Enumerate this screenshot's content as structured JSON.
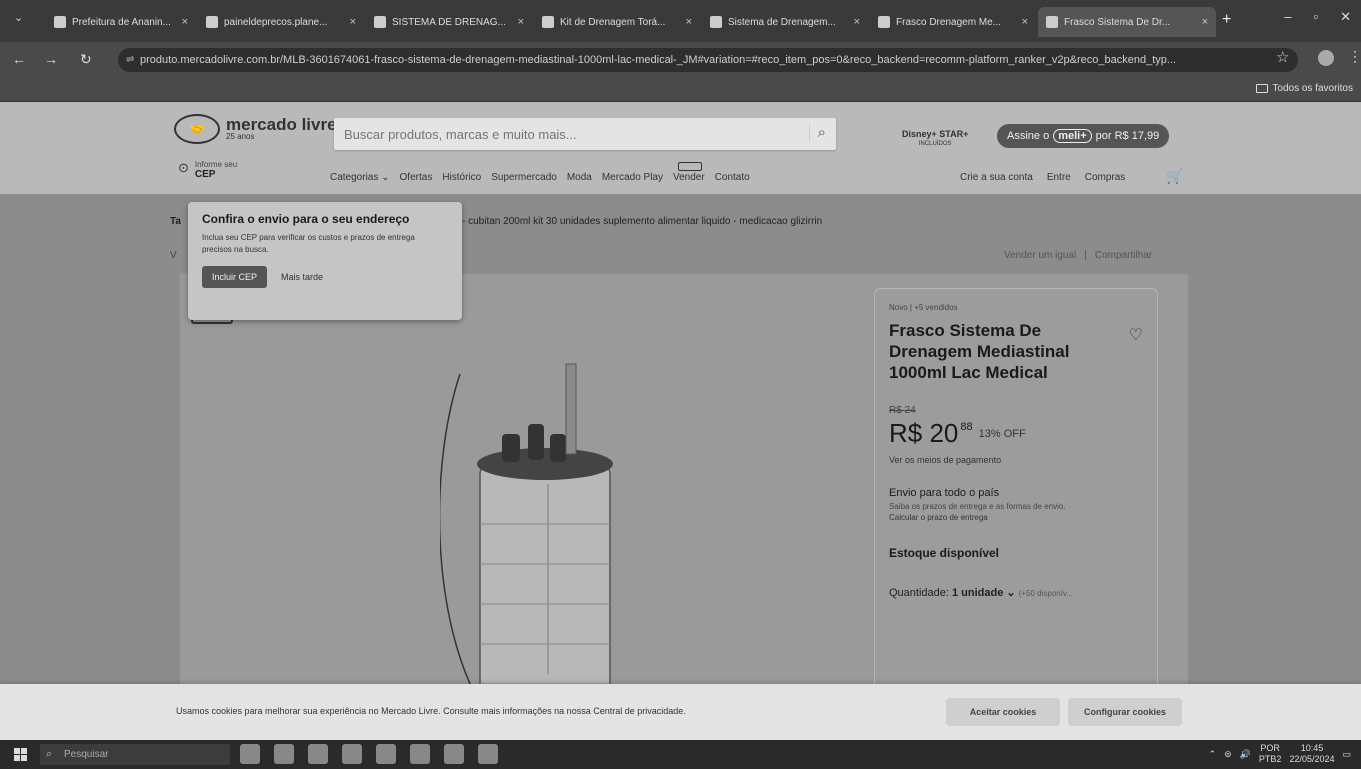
{
  "browser": {
    "tabs": [
      {
        "label": "Prefeitura de Ananin...",
        "active": false
      },
      {
        "label": "paineldeprecos.plane...",
        "active": false
      },
      {
        "label": "SISTEMA DE DRENAG...",
        "active": false
      },
      {
        "label": "Kit de Drenagem Torá...",
        "active": false
      },
      {
        "label": "Sistema de Drenagem...",
        "active": false
      },
      {
        "label": "Frasco Drenagem Me...",
        "active": false
      },
      {
        "label": "Frasco Sistema De Dr...",
        "active": true
      }
    ],
    "url": "produto.mercadolivre.com.br/MLB-3601674061-frasco-sistema-de-drenagem-mediastinal-1000ml-lac-medical-_JM#variation=#reco_item_pos=0&reco_backend=recomm-platform_ranker_v2p&reco_backend_typ...",
    "bookmarks_all": "Todos os favoritos"
  },
  "header": {
    "logo_text": "mercado livre",
    "logo_sub": "25 anos",
    "search_placeholder": "Buscar produtos, marcas e muito mais...",
    "disney_text": "Disney+ STAR+",
    "disney_sub": "INCLUÍDOS",
    "meli_prefix": "Assine o",
    "meli_badge": "meli+",
    "meli_price": "por R$ 17,99",
    "cep_label": "Informe seu",
    "cep_value": "CEP",
    "menu": [
      "Categorias ⌄",
      "Ofertas",
      "Histórico",
      "Supermercado",
      "Moda",
      "Mercado Play",
      "Vender",
      "Contato"
    ],
    "account": [
      "Crie a sua conta",
      "Entre",
      "Compras"
    ]
  },
  "related_prefix": "Ta",
  "related_text": "- cubitan 200ml kit 30 unidades suplemento alimentar liquido - medicacao glizirrin",
  "vo_prefix": "V",
  "top_actions": {
    "sell": "Vender um igual",
    "share": "Compartilhar"
  },
  "popover": {
    "title": "Confira o envio para o seu endereço",
    "text": "Inclua seu CEP para verificar os custos e prazos de entrega precisos na busca.",
    "primary": "Incluir CEP",
    "secondary": "Mais tarde"
  },
  "product": {
    "status": "Novo | +5 vendidos",
    "title": "Frasco Sistema De Drenagem Mediastinal 1000ml Lac Medical",
    "old_price": "R$ 24",
    "price": "R$ 20",
    "cents": "88",
    "discount": "13% OFF",
    "payment_link": "Ver os meios de pagamento",
    "ship_title": "Envio para todo o país",
    "ship_sub": "Saiba os prazos de entrega e as formas de envio.",
    "ship_calc": "Calcular o prazo de entrega",
    "stock": "Estoque disponível",
    "qty_label": "Quantidade:",
    "qty_value": "1 unidade ⌄",
    "qty_avail": "(+50 disponív..."
  },
  "cookies": {
    "text": "Usamos cookies para melhorar sua experiência no Mercado Livre. Consulte mais informações na nossa Central de privacidade.",
    "accept": "Aceitar cookies",
    "config": "Configurar cookies"
  },
  "taskbar": {
    "search": "Pesquisar",
    "lang1": "POR",
    "lang2": "PTB2",
    "time": "10:45",
    "date": "22/05/2024"
  }
}
